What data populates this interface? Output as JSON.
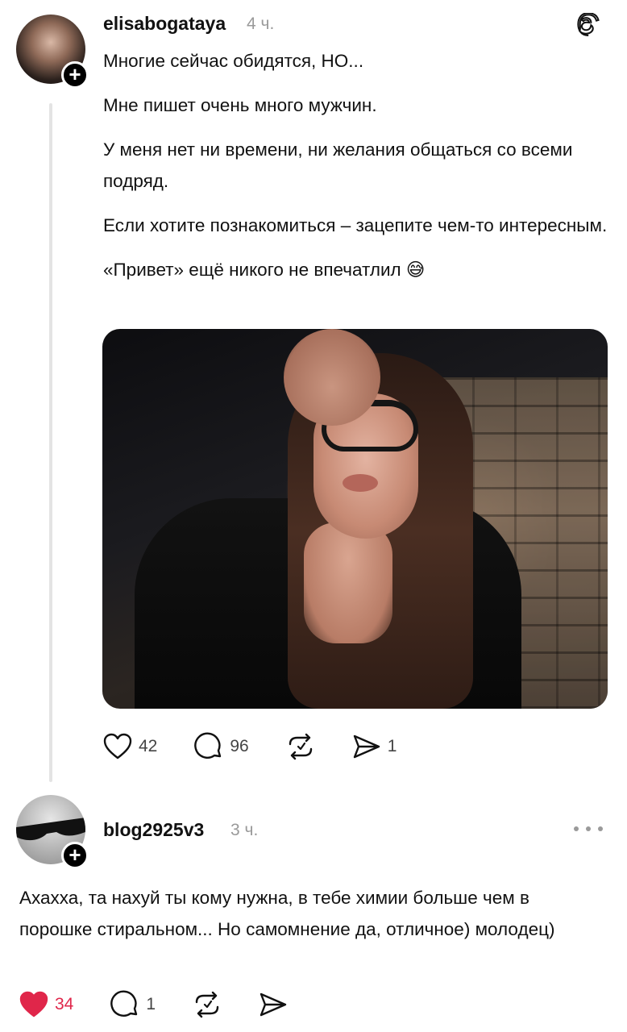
{
  "post": {
    "author": "elisabogataya",
    "time": "4 ч.",
    "paragraphs": [
      "Многие сейчас обидятся, НО...",
      "Мне пишет очень много мужчин.",
      "У меня нет ни времени, ни желания общаться со всеми подряд.",
      "Если хотите познакомиться – зацепите чем-то интересным.",
      "«Привет» ещё никого не впечатлил 😅"
    ],
    "likes": "42",
    "replies": "96",
    "shares": "1"
  },
  "reply": {
    "author": "blog2925v3",
    "time": "3 ч.",
    "text": "Ахахха, та нахуй ты кому нужна, в тебе химии больше чем в порошке стиральном... Но самомнение да, отличное) молодец)",
    "likes": "34",
    "replies": "1"
  },
  "icons": {
    "follow_badge": "+",
    "like": "heart-icon",
    "reply": "comment-icon",
    "repost": "repost-icon",
    "share": "send-icon",
    "more": "more-dots-icon",
    "app": "threads-logo-icon"
  },
  "colors": {
    "liked": "#e0264a",
    "muted": "#9a9a9a",
    "thread_line": "#e4e4e4"
  }
}
